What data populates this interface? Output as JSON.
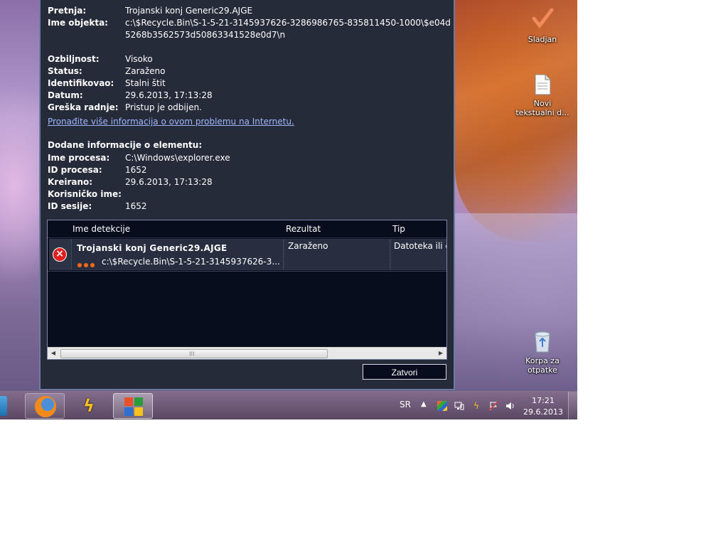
{
  "dialog": {
    "rows": [
      {
        "key": "Pretnja:",
        "value": "Trojanski konj Generic29.AJGE"
      },
      {
        "key": "Ime objekta:",
        "value": "c:\\$Recycle.Bin\\S-1-5-21-3145937626-3286986765-835811450-1000\\$e04d5268b3562573d50863341528e0d7\\n"
      },
      {
        "key": "Ozbiljnost:",
        "value": "Visoko"
      },
      {
        "key": "Status:",
        "value": "Zaraženo"
      },
      {
        "key": "Identifikovao:",
        "value": "Stalni štit"
      },
      {
        "key": "Datum:",
        "value": "29.6.2013, 17:13:28"
      },
      {
        "key": "Greška radnje:",
        "value": "Pristup je odbijen."
      }
    ],
    "info_link": "Pronađite više informacija o ovom problemu na Internetu.",
    "section_title": "Dodane informacije o elementu:",
    "extra_rows": [
      {
        "key": "Ime procesa:",
        "value": "C:\\Windows\\explorer.exe"
      },
      {
        "key": "ID procesa:",
        "value": "1652"
      },
      {
        "key": "Kreirano:",
        "value": "29.6.2013, 17:13:28"
      },
      {
        "key": "Korisničko ime:",
        "value": ""
      },
      {
        "key": "ID sesije:",
        "value": "1652"
      }
    ],
    "table": {
      "headers": {
        "name": "Ime detekcije",
        "result": "Rezultat",
        "type": "Tip"
      },
      "rows": [
        {
          "status_icon": "error-x-icon",
          "name": "Trojanski konj Generic29.AJGE",
          "path": "c:\\$Recycle.Bin\\S-1-5-21-3145937626-3...",
          "result": "Zaraženo",
          "type": "Datoteka ili d",
          "severity_dots": 3
        }
      ]
    },
    "close_label": "Zatvori"
  },
  "desktop_icons": [
    {
      "label": "Sladjan",
      "icon": "user-folder-icon"
    },
    {
      "label": "Novi tekstualni d...",
      "icon": "text-document-icon"
    },
    {
      "label": "Korpa za otpatke",
      "icon": "recycle-bin-icon"
    }
  ],
  "taskbar": {
    "buttons": [
      "firefox-icon",
      "winamp-icon",
      "avg-icon"
    ],
    "language": "SR",
    "clock_time": "17:21",
    "clock_date": "29.6.2013"
  },
  "colors": {
    "dialog_bg": "#262b3a",
    "table_bg": "#070d1c",
    "link": "#9fb6ff",
    "error": "#e02020",
    "severity": "#ff6a1a"
  }
}
